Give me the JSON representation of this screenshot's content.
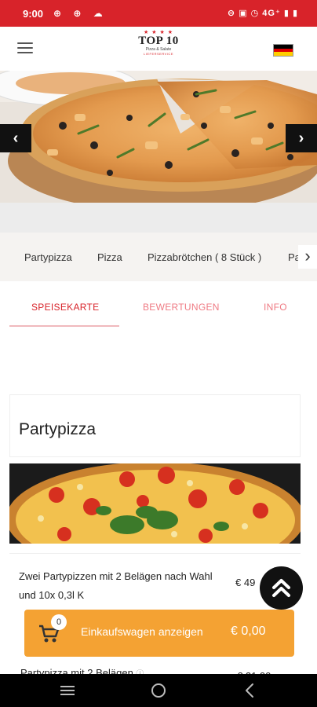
{
  "status_bar": {
    "time": "9:00",
    "left_icons": "⊕ ⊕ ☁",
    "right_icons": "⊖ ▣ ◷ 4G⁺ ▮ ▮",
    "background": "#d8232a"
  },
  "header": {
    "logo_top": "TOP 10",
    "logo_sub": "Pizza & Salate",
    "logo_sub2": "LIEFERSERVICE"
  },
  "categories": [
    "Partypizza",
    "Pizza",
    "Pizzabrötchen ( 8 Stück )",
    "Pa"
  ],
  "tabs": [
    "SPEISEKARTE",
    "BEWERTUNGEN",
    "INFO"
  ],
  "section": {
    "title": "Partypizza"
  },
  "items": [
    {
      "description": "Zwei Partypizzen mit 2 Belägen nach Wahl und 10x 0,3l K",
      "price": "€ 49"
    },
    {
      "name": "Partypizza mit 2 Belägen",
      "price": "€ 21,00"
    }
  ],
  "cart": {
    "count": "0",
    "label": "Einkaufswagen anzeigen",
    "total": "€ 0,00"
  },
  "colors": {
    "accent": "#d8232a",
    "cart": "#f4a233"
  }
}
